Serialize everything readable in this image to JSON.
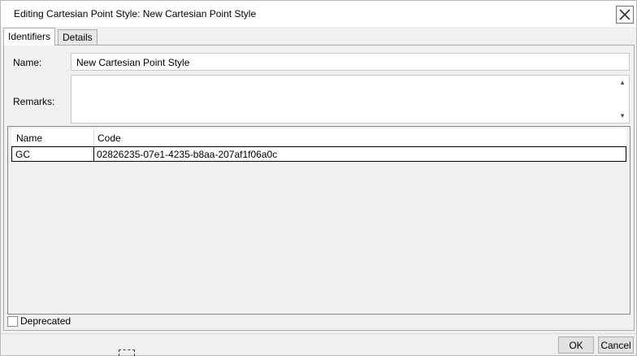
{
  "window": {
    "title": "Editing Cartesian Point Style: New Cartesian Point Style"
  },
  "tabs": [
    {
      "label": "Identifiers",
      "active": true
    },
    {
      "label": "Details",
      "active": false
    }
  ],
  "form": {
    "name_label": "Name:",
    "name_value": "New Cartesian Point Style",
    "remarks_label": "Remarks:",
    "remarks_value": ""
  },
  "identifiers_table": {
    "columns": [
      "Name",
      "Code"
    ],
    "rows": [
      {
        "name": "GC",
        "code": "02826235-07e1-4235-b8aa-207af1f06a0c"
      }
    ]
  },
  "deprecated": {
    "label": "Deprecated",
    "checked": false
  },
  "buttons": {
    "ok": "OK",
    "cancel": "Cancel"
  },
  "icons": {
    "close": "close-icon",
    "scroll_up": "scroll-up-icon",
    "scroll_down": "scroll-down-icon"
  }
}
